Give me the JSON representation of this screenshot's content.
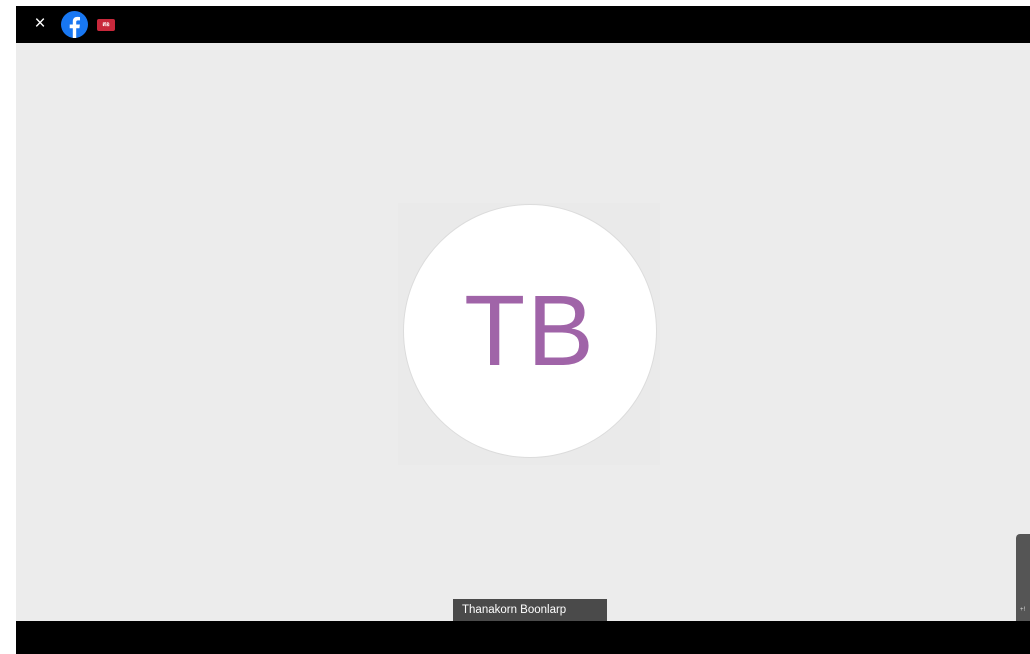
{
  "topbar": {
    "close_label": "×",
    "facebook_icon": "facebook-icon",
    "app_badge_label": "สอ",
    "app_badge_color": "#c8283b"
  },
  "participant": {
    "initials": "TB",
    "name": "Thanakorn Boonlarp",
    "initials_color": "#a064a8"
  },
  "side_handle": {
    "glyph": "+!"
  },
  "colors": {
    "stage_background": "#ececec",
    "bars": "#000000",
    "facebook_blue": "#1877f2"
  }
}
